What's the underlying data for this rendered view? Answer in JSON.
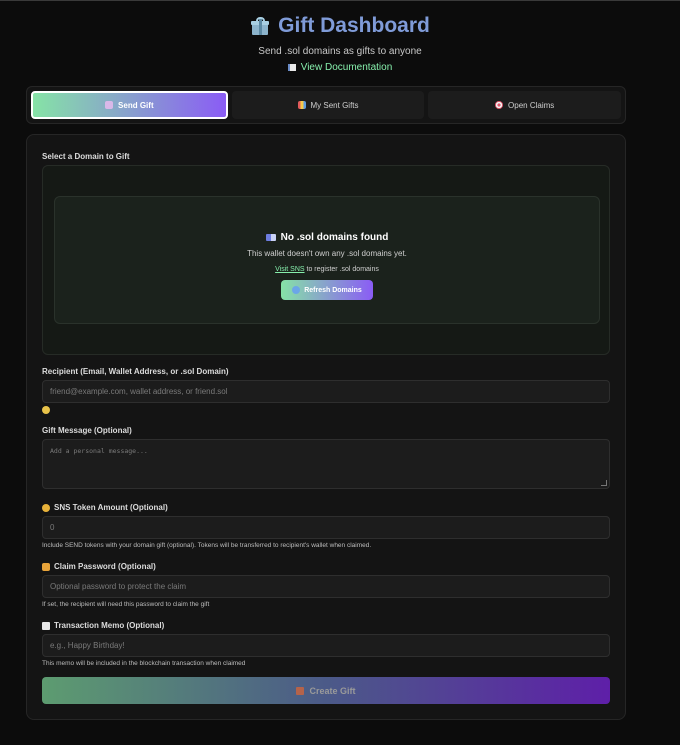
{
  "header": {
    "title": "Gift Dashboard",
    "subtitle": "Send .sol domains as gifts to anyone",
    "doc_link": "View Documentation"
  },
  "tabs": [
    {
      "label": "Send Gift",
      "icon": "gift-icon",
      "active": true
    },
    {
      "label": "My Sent Gifts",
      "icon": "chart-icon",
      "active": false
    },
    {
      "label": "Open Claims",
      "icon": "target-icon",
      "active": false
    }
  ],
  "form": {
    "domain_label": "Select a Domain to Gift",
    "empty": {
      "title": "No .sol domains found",
      "desc": "This wallet doesn't own any .sol domains yet.",
      "link": "Visit SNS",
      "hint_suffix": "to register .sol domains",
      "refresh": "Refresh Domains"
    },
    "recipient": {
      "label": "Recipient (Email, Wallet Address, or .sol Domain)",
      "placeholder": "friend@example.com, wallet address, or friend.sol"
    },
    "message": {
      "label": "Gift Message (Optional)",
      "placeholder": "Add a personal message..."
    },
    "tokens": {
      "label": "SNS Token Amount (Optional)",
      "value": "0",
      "help": "Include SEND tokens with your domain gift (optional). Tokens will be transferred to recipient's wallet when claimed."
    },
    "password": {
      "label": "Claim Password (Optional)",
      "placeholder": "Optional password to protect the claim",
      "help": "If set, the recipient will need this password to claim the gift"
    },
    "memo": {
      "label": "Transaction Memo (Optional)",
      "placeholder": "e.g., Happy Birthday!",
      "help": "This memo will be included in the blockchain transaction when claimed"
    },
    "submit": "Create Gift"
  },
  "colors": {
    "accent_green": "#86efac",
    "accent_purple": "#8a5cf5",
    "title_blue": "#7f9bd8"
  }
}
